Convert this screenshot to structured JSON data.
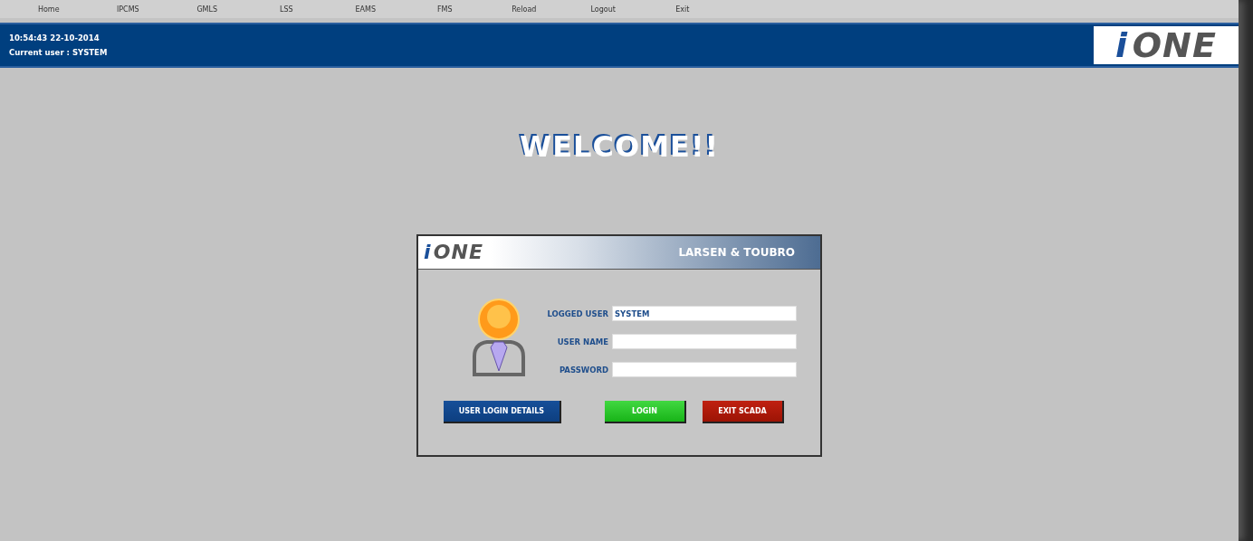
{
  "menu": [
    {
      "label": "Home"
    },
    {
      "label": "IPCMS"
    },
    {
      "label": "GMLS"
    },
    {
      "label": "LSS"
    },
    {
      "label": "EAMS"
    },
    {
      "label": "FMS"
    },
    {
      "label": "Reload"
    },
    {
      "label": "Logout"
    },
    {
      "label": "Exit"
    }
  ],
  "header": {
    "datetime": "10:54:43 22-10-2014",
    "current_user": "Current user :  SYSTEM",
    "logo": {
      "mark": "i",
      "word": "ONE"
    }
  },
  "welcome": "WELCOME!!",
  "dialog": {
    "logo": {
      "mark": "i",
      "word": "ONE"
    },
    "company": "LARSEN & TOUBRO",
    "fields": [
      {
        "label": "LOGGED USER",
        "value": "SYSTEM"
      },
      {
        "label": "USER NAME"
      },
      {
        "label": "PASSWORD"
      }
    ],
    "buttons": [
      {
        "label": "USER LOGIN DETAILS",
        "kind": "info"
      },
      {
        "label": "LOGIN",
        "kind": "confirm"
      },
      {
        "label": "EXIT SCADA",
        "kind": "danger"
      }
    ]
  }
}
